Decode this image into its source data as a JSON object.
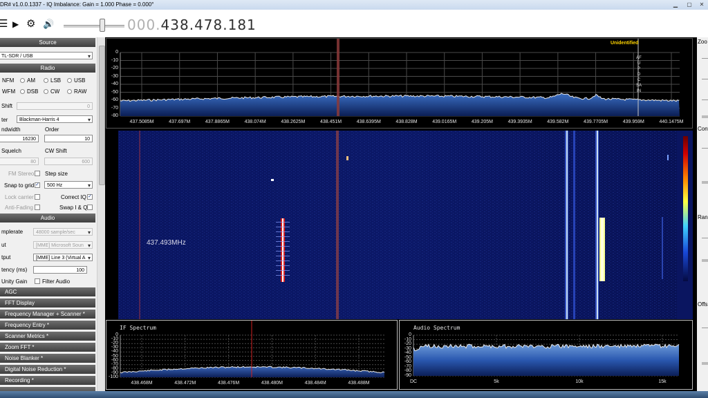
{
  "window": {
    "title": "DR# v1.0.0.1337 - IQ Imbalance: Gain = 1.000 Phase = 0.000°"
  },
  "toolbar": {
    "menu_icon": "☰",
    "play_icon": "▶",
    "settings_icon": "⚙",
    "volume_icon": "🔊"
  },
  "frequency": {
    "prefix": "000.",
    "value": "438.478.181"
  },
  "source": {
    "header": "Source",
    "device": "TL-SDR / USB"
  },
  "radio": {
    "header": "Radio",
    "modes": [
      {
        "label": "NFM",
        "selected": false
      },
      {
        "label": "AM",
        "selected": false
      },
      {
        "label": "LSB",
        "selected": false
      },
      {
        "label": "USB",
        "selected": false
      },
      {
        "label": "WFM",
        "selected": false
      },
      {
        "label": "DSB",
        "selected": false
      },
      {
        "label": "CW",
        "selected": false
      },
      {
        "label": "RAW",
        "selected": false
      }
    ],
    "shift_label": "Shift",
    "shift_value": "0",
    "filter_label": "ter",
    "filter_value": "Blackman-Harris 4",
    "bandwidth_label": "ndwidth",
    "bandwidth_value": "16230",
    "order_label": "Order",
    "order_value": "10",
    "squelch_label": "Squelch",
    "squelch_value": "80",
    "cwshift_label": "CW Shift",
    "cwshift_value": "600",
    "fmstereo_label": "FM Stereo",
    "stepsize_label": "Step size",
    "snap_label": "Snap to grid",
    "snap_checked": true,
    "step_value": "500 Hz",
    "lock_label": "Lock carrier",
    "correctiq_label": "Correct IQ",
    "correctiq_checked": true,
    "antifading_label": "Anti-Fading",
    "swapiq_label": "Swap I & Q"
  },
  "audio": {
    "header": "Audio",
    "samplerate_label": "mplerate",
    "samplerate_value": "48000 sample/sec",
    "input_label": "ut",
    "input_value": "[MME] Microsoft Soun",
    "output_label": "tput",
    "output_value": "[MME] Line 3 (Virtual A",
    "latency_label": "tency (ms)",
    "latency_value": "100",
    "unitygain_label": "Unity Gain",
    "filteraudio_label": "Filter Audio"
  },
  "collapsed_sections": [
    "AGC",
    "FFT Display",
    "Frequency Manager + Scanner *",
    "Frequency Entry *",
    "Scanner Metrics *",
    "Zoom FFT *",
    "Noise Blanker *",
    "Digital Noise Reduction *",
    "Recording *"
  ],
  "spectrum": {
    "label": "Unidentified",
    "vertical_label": "AFU PDCSAIN",
    "y_ticks": [
      "0",
      "-10",
      "-20",
      "-30",
      "-40",
      "-50",
      "-60",
      "-70",
      "-80"
    ],
    "x_ticks": [
      "437.5085M",
      "437.697M",
      "437.8865M",
      "438.074M",
      "438.2625M",
      "438.451M",
      "438.6395M",
      "438.828M",
      "439.0165M",
      "439.205M",
      "439.3935M",
      "439.582M",
      "439.7705M",
      "439.959M",
      "440.1475M"
    ]
  },
  "waterfall": {
    "marker_label": "437.493MHz"
  },
  "if_spectrum": {
    "title": "IF Spectrum",
    "y_ticks": [
      "0",
      "-10",
      "-20",
      "-30",
      "-40",
      "-50",
      "-60",
      "-70",
      "-80",
      "-90",
      "-100"
    ],
    "x_ticks": [
      "438.468M",
      "438.472M",
      "438.476M",
      "438.480M",
      "438.484M",
      "438.488M"
    ]
  },
  "audio_spectrum": {
    "title": "Audio Spectrum",
    "y_ticks": [
      "0",
      "-10",
      "-20",
      "-30",
      "-40",
      "-50",
      "-60",
      "-70",
      "-80",
      "-90"
    ],
    "x_ticks": [
      "DC",
      "5k",
      "10k",
      "15k"
    ]
  },
  "right_panel": {
    "labels": [
      "Zoo",
      "Contr",
      "Rang",
      "Offs"
    ]
  },
  "colors": {
    "spectrum_fill": "#1c3f8a",
    "waterfall_bg": "#0a1560",
    "marker": "#c33a3a",
    "label_yellow": "#ffd400"
  }
}
